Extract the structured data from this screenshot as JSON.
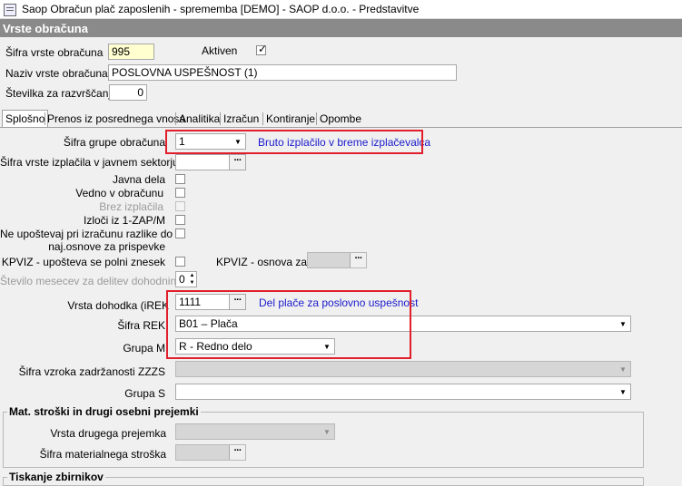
{
  "window": {
    "title": "Saop Obračun plač zaposlenih - sprememba [DEMO] - SAOP d.o.o. - Predstavitve"
  },
  "section": {
    "title": "Vrste obračuna"
  },
  "header": {
    "sifra_label": "Šifra vrste obračuna",
    "sifra_value": "995",
    "aktiven_label": "Aktiven",
    "aktiven_checked": true,
    "naziv_label": "Naziv vrste obračuna",
    "naziv_value": "POSLOVNA USPEŠNOST (1)",
    "stevilka_label": "Številka  za razvrščanje",
    "stevilka_value": "0"
  },
  "tabs": [
    {
      "label": "Splošno",
      "active": true
    },
    {
      "label": "Prenos iz posrednega vnosa"
    },
    {
      "label": "Analitika"
    },
    {
      "label": "Izračun"
    },
    {
      "label": "Kontiranje"
    },
    {
      "label": "Opombe"
    }
  ],
  "general": {
    "grupa_label": "Šifra grupe obračuna",
    "grupa_value": "1",
    "grupa_desc": "Bruto izplačilo v breme izplačevalca",
    "izplacila_label": "Šifra vrste izplačila v javnem sektorju",
    "izplacila_value": "",
    "javna_dela_label": "Javna dela",
    "vedno_label": "Vedno v obračunu",
    "brez_label": "Brez izplačila",
    "izloci_label": "Izloči iz 1-ZAP/M",
    "neupostevaj_label_1": "Ne upoštevaj pri izračunu razlike do",
    "neupostevaj_label_2": "naj.osnove za prispevke",
    "kpviz_label": "KPVIZ - upošteva se polni znesek",
    "kpviz_osnova_label": "KPVIZ - osnova zap.",
    "kpviz_osnova_value": "",
    "mesecev_label": "Število mesecev za delitev dohodnine:",
    "mesecev_value": "0",
    "dohodek_label": "Vrsta dohodka (iREK",
    "dohodek_value": "1111",
    "dohodek_desc": "Del plače za poslovno uspešnost",
    "rek_label": "Šifra REK",
    "rek_value": "B01 – Plača",
    "grupam_label": "Grupa M",
    "grupam_value": "R - Redno delo",
    "vzrok_label": "Šifra vzroka zadržanosti ZZZS",
    "vzrok_value": "",
    "grupas_label": "Grupa S",
    "grupas_value": ""
  },
  "mat_stroski": {
    "legend": "Mat. stroški in drugi osebni prejemki",
    "prejemek_label": "Vrsta drugega prejemka",
    "prejemek_value": "",
    "strosek_label": "Šifra materialnega stroška",
    "strosek_value": ""
  },
  "tiskanje": {
    "legend": "Tiskanje zbirnikov"
  },
  "colors": {
    "highlight_border": "#e01f2a",
    "description_text": "#1a1acc",
    "section_header": "#8a8a8a"
  }
}
